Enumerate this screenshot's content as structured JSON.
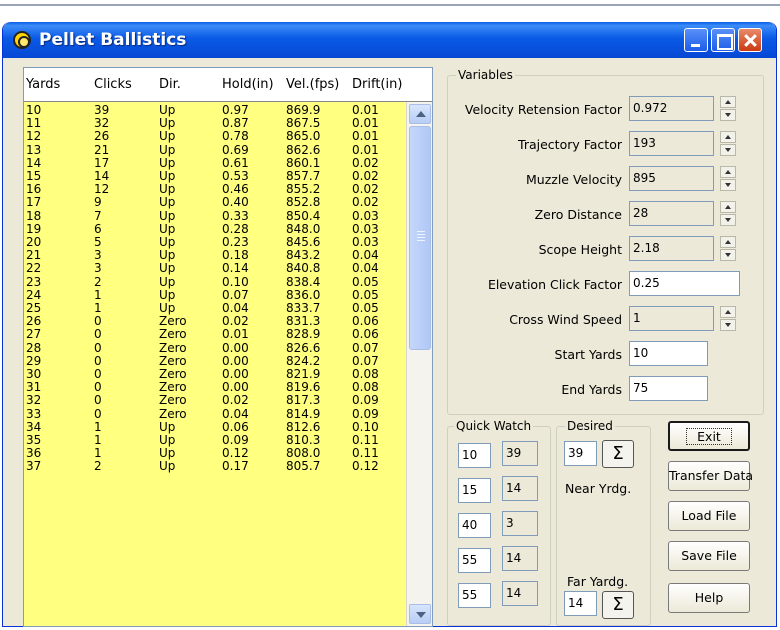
{
  "window": {
    "title": "Pellet Ballistics"
  },
  "table": {
    "headers": [
      "Yards",
      "Clicks",
      "Dir.",
      "Hold(in)",
      "Vel.(fps)",
      "Drift(in)"
    ],
    "rows": [
      [
        "10",
        "39",
        "Up",
        "0.97",
        "869.9",
        "0.01"
      ],
      [
        "11",
        "32",
        "Up",
        "0.87",
        "867.5",
        "0.01"
      ],
      [
        "12",
        "26",
        "Up",
        "0.78",
        "865.0",
        "0.01"
      ],
      [
        "13",
        "21",
        "Up",
        "0.69",
        "862.6",
        "0.01"
      ],
      [
        "14",
        "17",
        "Up",
        "0.61",
        "860.1",
        "0.02"
      ],
      [
        "15",
        "14",
        "Up",
        "0.53",
        "857.7",
        "0.02"
      ],
      [
        "16",
        "12",
        "Up",
        "0.46",
        "855.2",
        "0.02"
      ],
      [
        "17",
        "9",
        "Up",
        "0.40",
        "852.8",
        "0.02"
      ],
      [
        "18",
        "7",
        "Up",
        "0.33",
        "850.4",
        "0.03"
      ],
      [
        "19",
        "6",
        "Up",
        "0.28",
        "848.0",
        "0.03"
      ],
      [
        "20",
        "5",
        "Up",
        "0.23",
        "845.6",
        "0.03"
      ],
      [
        "21",
        "3",
        "Up",
        "0.18",
        "843.2",
        "0.04"
      ],
      [
        "22",
        "3",
        "Up",
        "0.14",
        "840.8",
        "0.04"
      ],
      [
        "23",
        "2",
        "Up",
        "0.10",
        "838.4",
        "0.05"
      ],
      [
        "24",
        "1",
        "Up",
        "0.07",
        "836.0",
        "0.05"
      ],
      [
        "25",
        "1",
        "Up",
        "0.04",
        "833.7",
        "0.05"
      ],
      [
        "26",
        "0",
        "Zero",
        "0.02",
        "831.3",
        "0.06"
      ],
      [
        "27",
        "0",
        "Zero",
        "0.01",
        "828.9",
        "0.06"
      ],
      [
        "28",
        "0",
        "Zero",
        "0.00",
        "826.6",
        "0.07"
      ],
      [
        "29",
        "0",
        "Zero",
        "0.00",
        "824.2",
        "0.07"
      ],
      [
        "30",
        "0",
        "Zero",
        "0.00",
        "821.9",
        "0.08"
      ],
      [
        "31",
        "0",
        "Zero",
        "0.00",
        "819.6",
        "0.08"
      ],
      [
        "32",
        "0",
        "Zero",
        "0.02",
        "817.3",
        "0.09"
      ],
      [
        "33",
        "0",
        "Zero",
        "0.04",
        "814.9",
        "0.09"
      ],
      [
        "34",
        "1",
        "Up",
        "0.06",
        "812.6",
        "0.10"
      ],
      [
        "35",
        "1",
        "Up",
        "0.09",
        "810.3",
        "0.11"
      ],
      [
        "36",
        "1",
        "Up",
        "0.12",
        "808.0",
        "0.11"
      ],
      [
        "37",
        "2",
        "Up",
        "0.17",
        "805.7",
        "0.12"
      ]
    ]
  },
  "variables": {
    "title": "Variables",
    "velocity_retention": {
      "label": "Velocity Retension Factor",
      "value": "0.972"
    },
    "trajectory_factor": {
      "label": "Trajectory Factor",
      "value": "193"
    },
    "muzzle_velocity": {
      "label": "Muzzle Velocity",
      "value": "895"
    },
    "zero_distance": {
      "label": "Zero Distance",
      "value": "28"
    },
    "scope_height": {
      "label": "Scope Height",
      "value": "2.18"
    },
    "elevation_click": {
      "label": "Elevation Click Factor",
      "value": "0.25"
    },
    "cross_wind": {
      "label": "Cross Wind Speed",
      "value": "1"
    },
    "start_yards": {
      "label": "Start Yards",
      "value": "10"
    },
    "end_yards": {
      "label": "End Yards",
      "value": "75"
    }
  },
  "quick_watch": {
    "title": "Quick Watch",
    "rows": [
      {
        "yards": "10",
        "clicks": "39"
      },
      {
        "yards": "15",
        "clicks": "14"
      },
      {
        "yards": "40",
        "clicks": "3"
      },
      {
        "yards": "55",
        "clicks": "14"
      },
      {
        "yards": "55",
        "clicks": "14"
      }
    ]
  },
  "desired": {
    "title": "Desired",
    "near_value": "39",
    "near_label": "Near Yrdg.",
    "far_value": "14",
    "far_label": "Far Yardg.",
    "sigma": "Σ"
  },
  "buttons": {
    "exit": "Exit",
    "transfer": "Transfer Data",
    "load": "Load File",
    "save": "Save File",
    "help": "Help"
  },
  "colors": {
    "table_bg": "#ffff80",
    "titlebar": "#0a5ae6",
    "window_bg": "#ece9d8"
  }
}
